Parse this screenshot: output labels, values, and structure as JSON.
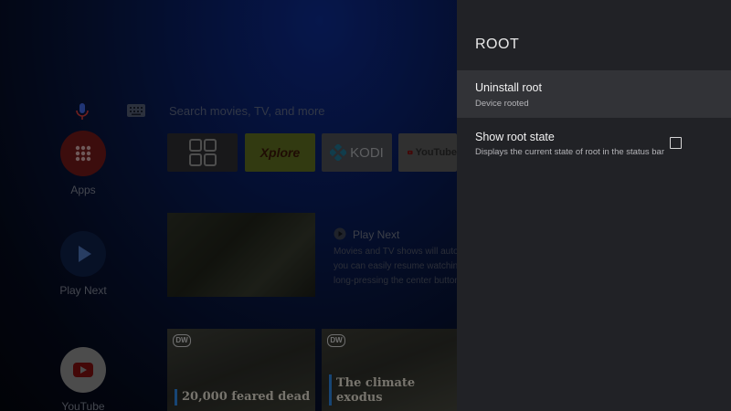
{
  "launcher": {
    "search_placeholder": "Search movies, TV, and more",
    "rail": [
      {
        "label": "Apps",
        "icon": "apps-grid-icon",
        "color": "#c62828"
      },
      {
        "label": "Play Next",
        "icon": "play-icon",
        "color": "#1565c0"
      },
      {
        "label": "YouTube",
        "icon": "youtube-icon",
        "color": "#ffffff"
      }
    ],
    "apps": [
      {
        "name": "xplore",
        "text": "Xplore"
      },
      {
        "name": "kodi",
        "text": "KODI"
      },
      {
        "name": "youtube",
        "text": "YouTube"
      }
    ],
    "play_next": {
      "title": "Play Next",
      "desc": [
        "Movies and TV shows will auto",
        "you can easily resume watching",
        "long-pressing the center button"
      ]
    },
    "news": [
      {
        "lines": [
          "20,000 feared dead"
        ]
      },
      {
        "lines": [
          "The climate",
          "exodus"
        ]
      }
    ],
    "news_badge": "DW"
  },
  "settings": {
    "title": "ROOT",
    "items": [
      {
        "title": "Uninstall root",
        "subtitle": "Device rooted",
        "focused": true
      },
      {
        "title": "Show root state",
        "subtitle": "Displays the current state of root in the status bar",
        "checked": false
      }
    ]
  },
  "colors": {
    "panel_bg": "#212226",
    "focused_row": "#323337",
    "accent_blue": "#0b2a8a"
  }
}
